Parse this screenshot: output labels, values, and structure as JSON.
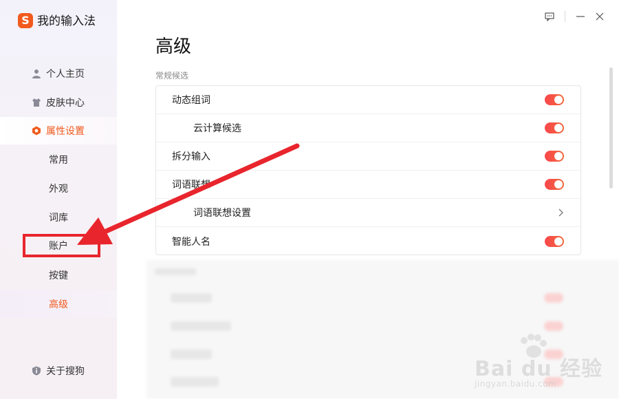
{
  "app": {
    "logo_glyph": "S",
    "title": "我的输入法"
  },
  "sidebar": {
    "nav": [
      {
        "label": "个人主页",
        "icon": "user-icon"
      },
      {
        "label": "皮肤中心",
        "icon": "shirt-icon"
      },
      {
        "label": "属性设置",
        "icon": "hexagon-settings-icon"
      }
    ],
    "sub": [
      {
        "label": "常用"
      },
      {
        "label": "外观"
      },
      {
        "label": "词库"
      },
      {
        "label": "账户"
      },
      {
        "label": "按键"
      },
      {
        "label": "高级"
      }
    ],
    "about": {
      "label": "关于搜狗",
      "icon": "info-shield-icon"
    }
  },
  "window": {
    "feedback": "feedback-icon",
    "minimize": "minimize-icon",
    "close": "close-icon"
  },
  "main": {
    "title": "高级",
    "section": "常规候选",
    "rows": [
      {
        "label": "动态组词"
      },
      {
        "label": "云计算候选"
      },
      {
        "label": "拆分输入"
      },
      {
        "label": "词语联想"
      },
      {
        "label": "词语联想设置"
      },
      {
        "label": "智能人名"
      }
    ]
  },
  "colors": {
    "accent": "#f05a1e",
    "toggle": "#f9474c",
    "annotation": "#e8252d"
  },
  "watermark": {
    "brand": "Bai du 经验",
    "url": "jingyan.baidu.com"
  }
}
